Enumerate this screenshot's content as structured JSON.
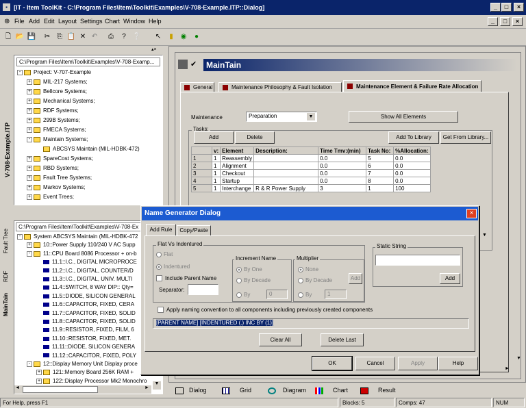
{
  "app": {
    "title": "[IT - Item ToolKit - C:\\Program Files\\Item\\Toolkit\\Examples\\V-708-Example.ITP::Dialog]",
    "colors": {
      "titlebar": "#0a246a",
      "dialog_title": "#1c5bd1"
    }
  },
  "menu": [
    "File",
    "Add",
    "Edit",
    "Layout",
    "Settings",
    "Chart",
    "Window",
    "Help"
  ],
  "left_top": {
    "tab": "V-708-Example.ITP",
    "path": "C:\\Program Files\\Item\\Toolkit\\Examples\\V-708-Examp...",
    "tree": [
      {
        "label": "Project: V-707-Example",
        "level": 0,
        "pm": "-"
      },
      {
        "label": "MIL-217 Systems;",
        "level": 1,
        "pm": "+"
      },
      {
        "label": "Bellcore Systems;",
        "level": 1,
        "pm": "+"
      },
      {
        "label": "Mechanical Systems;",
        "level": 1,
        "pm": "+"
      },
      {
        "label": "RDF Systems;",
        "level": 1,
        "pm": "+"
      },
      {
        "label": "299B Systems;",
        "level": 1,
        "pm": "+"
      },
      {
        "label": "FMECA Systems;",
        "level": 1,
        "pm": "+"
      },
      {
        "label": "Maintain Systems;",
        "level": 1,
        "pm": "-"
      },
      {
        "label": "ABCSYS Maintain (MIL-HDBK-472)",
        "level": 2,
        "pm": ""
      },
      {
        "label": "SpareCost Systems;",
        "level": 1,
        "pm": "+"
      },
      {
        "label": "RBD Systems;",
        "level": 1,
        "pm": "+"
      },
      {
        "label": "Fault Tree Systems;",
        "level": 1,
        "pm": "+"
      },
      {
        "label": "Markov Systems;",
        "level": 1,
        "pm": "+"
      },
      {
        "label": "Event Trees;",
        "level": 1,
        "pm": "+"
      }
    ]
  },
  "left_bottom": {
    "tabs": [
      "Fault Tree",
      "RDF",
      "MainTain"
    ],
    "path": "C:\\Program Files\\Item\\Toolkit\\Examples\\V-708-Ex",
    "tree": [
      {
        "label": "System ABCSYS Maintain (MIL-HDBK-472",
        "level": 0,
        "kind": "fold",
        "pm": "-"
      },
      {
        "label": "10::Power Supply 110/240 V AC Supp",
        "level": 1,
        "kind": "fold",
        "pm": "+"
      },
      {
        "label": "11::CPU Board 8086 Processor + on-b",
        "level": 1,
        "kind": "fold",
        "pm": "-"
      },
      {
        "label": "11.1::I.C., DIGITAL MICROPROCE",
        "level": 2,
        "kind": "blk"
      },
      {
        "label": "11.2::I.C., DIGITAL, COUNTER/D",
        "level": 2,
        "kind": "blk"
      },
      {
        "label": "11.3::I.C., DIGITAL, UNIV. MULTI",
        "level": 2,
        "kind": "blk"
      },
      {
        "label": "11.4::SWITCH, 8 WAY DIP:: Qty=",
        "level": 2,
        "kind": "blk"
      },
      {
        "label": "11.5::DIODE, SILICON GENERAL",
        "level": 2,
        "kind": "blk"
      },
      {
        "label": "11.6::CAPACITOR, FIXED, CERA",
        "level": 2,
        "kind": "blk"
      },
      {
        "label": "11.7::CAPACITOR, FIXED, SOLID",
        "level": 2,
        "kind": "blk"
      },
      {
        "label": "11.8::CAPACITOR, FIXED, SOLID",
        "level": 2,
        "kind": "blk"
      },
      {
        "label": "11.9::RESISTOR, FIXED, FILM, 6",
        "level": 2,
        "kind": "blk"
      },
      {
        "label": "11.10::RESISTOR, FIXED, MET.",
        "level": 2,
        "kind": "blk"
      },
      {
        "label": "11.11::DIODE, SILICON GENERA",
        "level": 2,
        "kind": "blk"
      },
      {
        "label": "11.12::CAPACITOR, FIXED, POLY",
        "level": 2,
        "kind": "blk"
      },
      {
        "label": "12::Display Memory Unit Display proce",
        "level": 1,
        "kind": "fold",
        "pm": "-"
      },
      {
        "label": "121::Memory Board 256K RAM +",
        "level": 2,
        "kind": "fold",
        "pm": "+"
      },
      {
        "label": "122::Display Processor Mk2 Monochro",
        "level": 2,
        "kind": "fold",
        "pm": "+"
      }
    ]
  },
  "main": {
    "title": "MainTain",
    "tabs": [
      "General",
      "Maintenance Philosophy & Fault Isolation",
      "Maintenance Element & Failure Rate Allocation"
    ],
    "maintenance_label": "Maintenance",
    "maintenance_value": "Preparation",
    "show_all": "Show All Elements",
    "tasks_label": "Tasks:",
    "add": "Add",
    "delete": "Delete",
    "add_to_library": "Add To Library",
    "get_from_library": "Get From Library...",
    "columns": [
      "",
      "v:",
      "Element",
      "Description:",
      "Time Tmv:(min)",
      "Task No:",
      "%Allocation:"
    ],
    "rows": [
      [
        "1",
        "1",
        "Reassembly",
        "",
        "0.0",
        "5",
        "0.0"
      ],
      [
        "2",
        "1",
        "Alignment",
        "",
        "0.0",
        "6",
        "0.0"
      ],
      [
        "3",
        "1",
        "Checkout",
        "",
        "0.0",
        "7",
        "0.0"
      ],
      [
        "4",
        "1",
        "Startup",
        "",
        "0.0",
        "8",
        "0.0"
      ],
      [
        "5",
        "1",
        "Interchange",
        "R & R Power Supply",
        "3",
        "1",
        "100"
      ]
    ]
  },
  "dialog": {
    "title": "Name Generator Dialog",
    "tabs": [
      "Add Rule",
      "Copy/Paste"
    ],
    "flat_group": "Flat Vs Indentured",
    "flat": "Flat",
    "indentured": "Indentured",
    "include_parent": "Include Parent Name",
    "separator": "Separator:",
    "increment_group": "Increment Name",
    "by_one": "By One",
    "by_decade": "By Decade",
    "by": "By",
    "inc_value": "0",
    "multiplier_group": "Multiplier",
    "none": "None",
    "m_by_decade": "By Decade",
    "m_by": "By",
    "mult_value": "1",
    "mult_add": "Add",
    "static_group": "Static String",
    "static_add": "Add",
    "apply_naming": "Apply naming convention to all components including previously created components",
    "rule": "[PARENT NAME] [INDENTURED (.) INC BY (1)]",
    "clear_all": "Clear All",
    "delete_last": "Delete Last",
    "ok": "OK",
    "cancel": "Cancel",
    "apply": "Apply",
    "help": "Help"
  },
  "bottom_tabs": [
    "Dialog",
    "Grid",
    "Diagram",
    "Chart",
    "Result"
  ],
  "status": {
    "help": "For Help, press F1",
    "blocks": "Blocks: 5",
    "comps": "Comps: 47",
    "num": "NUM"
  }
}
